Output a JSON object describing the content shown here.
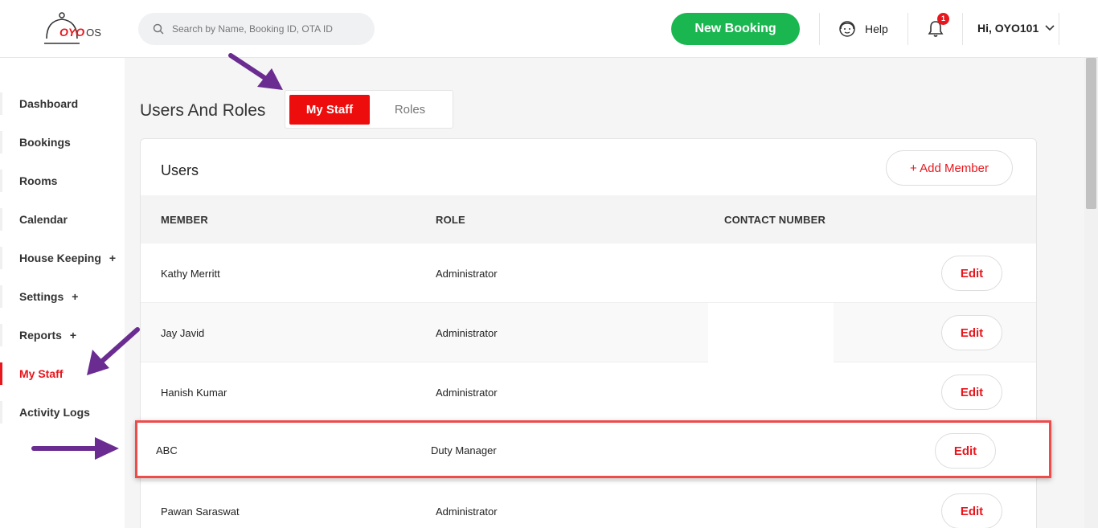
{
  "header": {
    "logo_brand": "OYO",
    "logo_suffix": "OS",
    "search_placeholder": "Search by Name, Booking ID, OTA ID",
    "new_booking_label": "New Booking",
    "help_label": "Help",
    "notification_count": "1",
    "user_greeting": "Hi, OYO101"
  },
  "sidebar": {
    "items": [
      {
        "label": "Dashboard",
        "plus": ""
      },
      {
        "label": "Bookings",
        "plus": ""
      },
      {
        "label": "Rooms",
        "plus": ""
      },
      {
        "label": "Calendar",
        "plus": ""
      },
      {
        "label": "House Keeping",
        "plus": "+"
      },
      {
        "label": "Settings",
        "plus": "+"
      },
      {
        "label": "Reports",
        "plus": "+"
      },
      {
        "label": "My Staff",
        "plus": ""
      },
      {
        "label": "Activity Logs",
        "plus": ""
      }
    ]
  },
  "main": {
    "title": "Users And Roles",
    "tabs": [
      {
        "label": "My Staff"
      },
      {
        "label": "Roles"
      }
    ],
    "card": {
      "title": "Users",
      "add_member_label": "+  Add Member",
      "columns": [
        "MEMBER",
        "ROLE",
        "CONTACT NUMBER"
      ],
      "rows": [
        {
          "member": "Kathy Merritt",
          "role": "Administrator",
          "contact": "",
          "action": "Edit"
        },
        {
          "member": "Jay Javid",
          "role": "Administrator",
          "contact": "",
          "action": "Edit"
        },
        {
          "member": "Hanish Kumar",
          "role": "Administrator",
          "contact": "",
          "action": "Edit"
        },
        {
          "member": "ABC",
          "role": "Duty Manager",
          "contact": "",
          "action": "Edit"
        },
        {
          "member": "Pawan Saraswat",
          "role": "Administrator",
          "contact": "",
          "action": "Edit"
        }
      ]
    }
  },
  "colors": {
    "brand_red": "#e8161d",
    "accent_green": "#1ab64f",
    "annotation_purple": "#6a2c91",
    "highlight_border": "#ee4b4b"
  }
}
